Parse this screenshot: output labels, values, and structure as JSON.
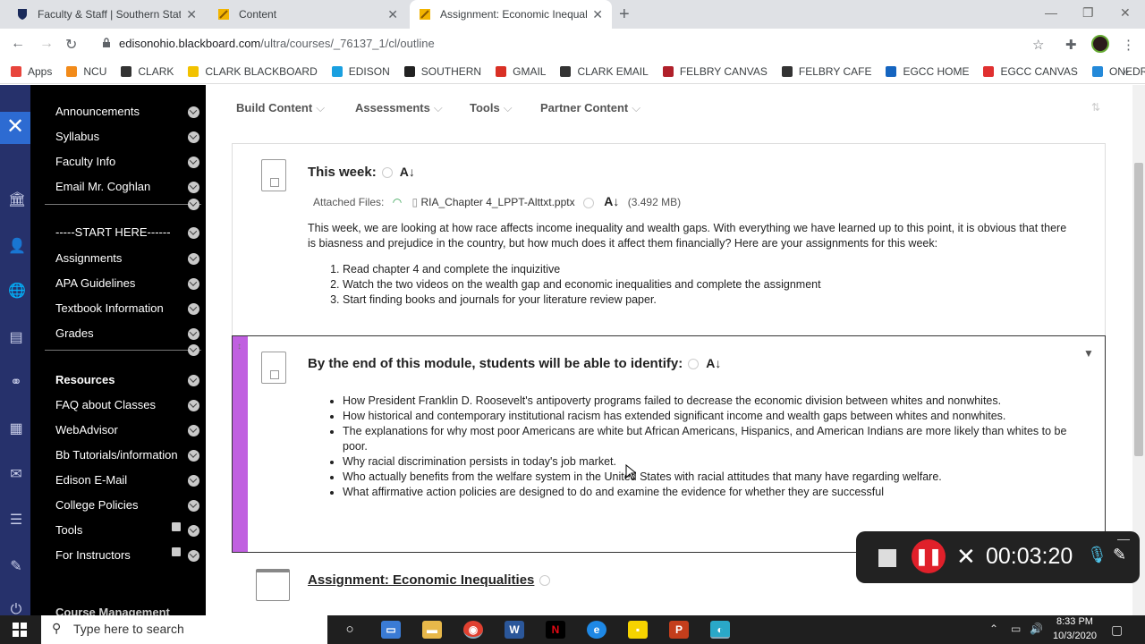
{
  "browser": {
    "tabs": [
      {
        "title": "Faculty & Staff | Southern State C",
        "close": "✕"
      },
      {
        "title": "Content",
        "close": "✕"
      },
      {
        "title": "Assignment: Economic Inequaliti",
        "close": "✕"
      }
    ],
    "new_tab": "+",
    "url_host": "edisonohio.blackboard.com",
    "url_path": "/ultra/courses/_76137_1/cl/outline",
    "bookmarks": [
      {
        "label": "Apps",
        "color": "#e8453c"
      },
      {
        "label": "NCU",
        "color": "#f28b1a"
      },
      {
        "label": "CLARK",
        "color": "#333333"
      },
      {
        "label": "CLARK BLACKBOARD",
        "color": "#f2c200"
      },
      {
        "label": "EDISON",
        "color": "#1aa0e0"
      },
      {
        "label": "SOUTHERN",
        "color": "#222222"
      },
      {
        "label": "GMAIL",
        "color": "#d93025"
      },
      {
        "label": "CLARK EMAIL",
        "color": "#333333"
      },
      {
        "label": "FELBRY CANVAS",
        "color": "#b0202a"
      },
      {
        "label": "FELBRY CAFE",
        "color": "#333333"
      },
      {
        "label": "EGCC HOME",
        "color": "#1565c0"
      },
      {
        "label": "EGCC CANVAS",
        "color": "#e03030"
      },
      {
        "label": "ONEDRIVE",
        "color": "#2489d9"
      }
    ],
    "bookmarks_more": "»"
  },
  "rail": {
    "close": "✕"
  },
  "course_menu": {
    "items": [
      {
        "label": "Announcements",
        "bold": false
      },
      {
        "label": "Syllabus",
        "bold": false
      },
      {
        "label": "Faculty Info",
        "bold": false
      },
      {
        "label": "Email Mr. Coghlan",
        "bold": false
      },
      {
        "label": "-----START HERE------",
        "bold": false
      },
      {
        "label": "Assignments",
        "bold": false
      },
      {
        "label": "APA Guidelines",
        "bold": false
      },
      {
        "label": "Textbook Information",
        "bold": false
      },
      {
        "label": "Grades",
        "bold": false
      },
      {
        "label": "Resources",
        "bold": true
      },
      {
        "label": "FAQ about Classes",
        "bold": false
      },
      {
        "label": "WebAdvisor",
        "bold": false
      },
      {
        "label": "Bb Tutorials/information",
        "bold": false
      },
      {
        "label": "Edison E-Mail",
        "bold": false
      },
      {
        "label": "College Policies",
        "bold": false
      },
      {
        "label": "Tools",
        "bold": false
      },
      {
        "label": "For Instructors",
        "bold": false
      }
    ],
    "footer": "Course Management"
  },
  "toolbar": {
    "build": "Build Content",
    "assessments": "Assessments",
    "tools": "Tools",
    "partner": "Partner Content",
    "chev": "⌵"
  },
  "item1": {
    "title": "This week:",
    "attached_label": "Attached Files:",
    "file_name": "RIA_Chapter 4_LPPT-Alttxt.pptx",
    "file_size": "(3.492 MB)",
    "paragraph": "This week, we are looking at how race affects income inequality and wealth gaps.  With everything we have learned up to this point, it is obvious that there is biasness and prejudice in the country, but how much does it affect them financially?  Here are your assignments for this week:",
    "steps": [
      "Read chapter 4 and complete the inquizitive",
      "Watch the two videos on the wealth gap and economic inequalities and complete the assignment",
      "Start finding books and journals for your literature review paper."
    ]
  },
  "item2": {
    "title": "By the end of this module, students will be able to identify:",
    "bullets": [
      "How President Franklin D. Roosevelt's antipoverty programs failed to decrease the economic division between whites and nonwhites.",
      "How historical and contemporary institutional racism has extended significant income and wealth gaps between whites and nonwhites.",
      "The explanations for why most poor Americans are white but African Americans, Hispanics, and American Indians are more likely than whites to be poor.",
      "Why racial discrimination persists in today's job market.",
      "Who actually benefits from the welfare system in the United States with racial attitudes that many have regarding welfare.",
      "What affirmative action policies are designed to do and examine the evidence for whether they are successful"
    ]
  },
  "item3": {
    "title": "Assignment: Economic Inequalities"
  },
  "recorder": {
    "time": "00:03:20"
  },
  "taskbar": {
    "search_placeholder": "Type here to search",
    "time": "8:33 PM",
    "date": "10/3/2020"
  }
}
